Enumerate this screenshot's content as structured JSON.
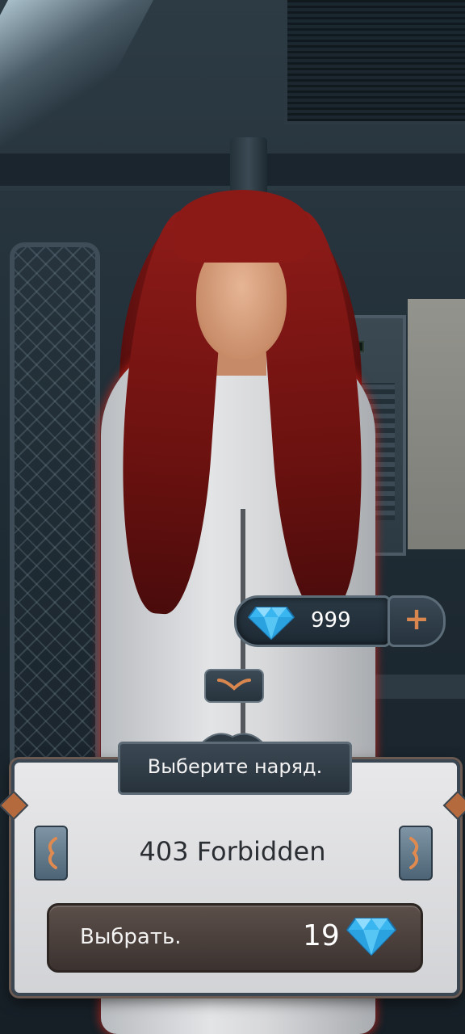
{
  "currency": {
    "gem_count": "999",
    "gem_icon": "diamond-icon",
    "plus_label": "+",
    "gem_color": "#4fc3f7"
  },
  "panel": {
    "title": "Выберите наряд.",
    "outfit_name": "403 Forbidden",
    "select_label": "Выбрать.",
    "price": "19",
    "accent_color": "#b56a3e"
  }
}
